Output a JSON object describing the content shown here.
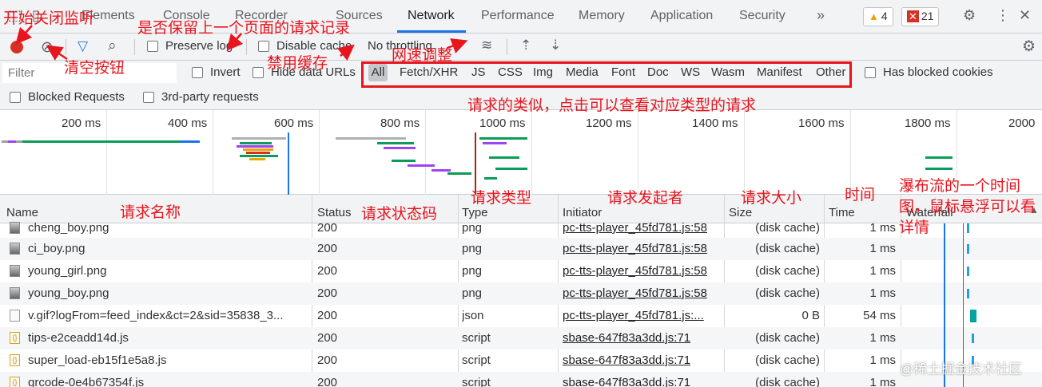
{
  "tabs": [
    {
      "label": "Elements"
    },
    {
      "label": "Console"
    },
    {
      "label": "Recorder"
    },
    {
      "label": "Sources"
    },
    {
      "label": "Network"
    },
    {
      "label": "Performance"
    },
    {
      "label": "Memory"
    },
    {
      "label": "Application"
    },
    {
      "label": "Security"
    }
  ],
  "more_tabs": "»",
  "warnings_count": "4",
  "errors_count": "21",
  "toolbar": {
    "preserve_log": "Preserve log",
    "disable_cache": "Disable cache",
    "throttling": "No throttling"
  },
  "filter": {
    "placeholder": "Filter",
    "invert": "Invert",
    "hide_data_urls": "Hide data URLs",
    "types": [
      "All",
      "Fetch/XHR",
      "JS",
      "CSS",
      "Img",
      "Media",
      "Font",
      "Doc",
      "WS",
      "Wasm",
      "Manifest",
      "Other"
    ],
    "has_blocked_cookies": "Has blocked cookies",
    "blocked_requests": "Blocked Requests",
    "third_party": "3rd-party requests"
  },
  "overview_ticks": [
    "200 ms",
    "400 ms",
    "600 ms",
    "800 ms",
    "1000 ms",
    "1200 ms",
    "1400 ms",
    "1600 ms",
    "1800 ms",
    "2000"
  ],
  "columns": [
    "Name",
    "Status",
    "Type",
    "Initiator",
    "Size",
    "Time",
    "Waterfall"
  ],
  "rows": [
    {
      "name": "cheng_boy.png",
      "status": "200",
      "type": "png",
      "initiator": "pc-tts-player_45fd781.js:58",
      "size": "(disk cache)",
      "time": "1 ms",
      "icon": "image-file-icon"
    },
    {
      "name": "ci_boy.png",
      "status": "200",
      "type": "png",
      "initiator": "pc-tts-player_45fd781.js:58",
      "size": "(disk cache)",
      "time": "1 ms",
      "icon": "image-file-icon"
    },
    {
      "name": "young_girl.png",
      "status": "200",
      "type": "png",
      "initiator": "pc-tts-player_45fd781.js:58",
      "size": "(disk cache)",
      "time": "1 ms",
      "icon": "image-file-icon"
    },
    {
      "name": "young_boy.png",
      "status": "200",
      "type": "png",
      "initiator": "pc-tts-player_45fd781.js:58",
      "size": "(disk cache)",
      "time": "1 ms",
      "icon": "image-file-icon"
    },
    {
      "name": "v.gif?logFrom=feed_index&ct=2&sid=35838_3...",
      "status": "200",
      "type": "json",
      "initiator": "pc-tts-player_45fd781.js:...",
      "size": "0 B",
      "time": "54 ms",
      "icon": "document-file-icon"
    },
    {
      "name": "tips-e2ceadd14d.js",
      "status": "200",
      "type": "script",
      "initiator": "sbase-647f83a3dd.js:71",
      "size": "(disk cache)",
      "time": "1 ms",
      "icon": "script-file-icon"
    },
    {
      "name": "super_load-eb15f1e5a8.js",
      "status": "200",
      "type": "script",
      "initiator": "sbase-647f83a3dd.js:71",
      "size": "(disk cache)",
      "time": "1 ms",
      "icon": "script-file-icon"
    },
    {
      "name": "qrcode-0e4b67354f.js",
      "status": "200",
      "type": "script",
      "initiator": "sbase-647f83a3dd.js:71",
      "size": "(disk cache)",
      "time": "1 ms",
      "icon": "script-file-icon"
    }
  ],
  "annotations": {
    "record": "开始关闭监听",
    "preserve": "是否保留上一个页面的请求记录",
    "clear": "清空按钮",
    "cache": "禁用缓存",
    "throttle": "网速调整",
    "types": "请求的类似，点击可以查看对应类型的请求",
    "name": "请求名称",
    "status": "请求状态码",
    "type": "请求类型",
    "initiator": "请求发起者",
    "size": "请求大小",
    "time": "时间",
    "waterfall": "瀑布流的一个时间图，鼠标悬浮可以看详情"
  },
  "watermark": "@稀土掘金技术社区",
  "colors": {
    "accent": "#1a73e8",
    "record": "#d93025",
    "annotation": "#e8141e"
  }
}
